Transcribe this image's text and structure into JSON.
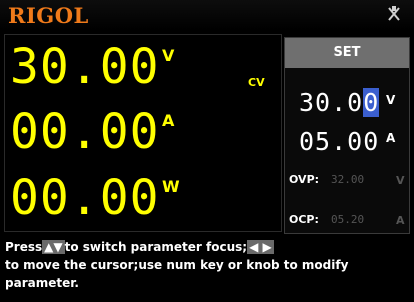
{
  "header": {
    "brand": "RIGOL",
    "status_icon": "no-connection-icon"
  },
  "measure": {
    "voltage": "30.00",
    "voltage_unit": "V",
    "current": "00.00",
    "current_unit": "A",
    "power": "00.00",
    "power_unit": "W",
    "mode": "CV"
  },
  "set_panel": {
    "title": "SET",
    "voltage_head": "30.0",
    "voltage_cursor": "0",
    "voltage_unit": "V",
    "current": "05.00",
    "current_unit": "A",
    "ovp_label": "OVP:",
    "ovp_value": "32.00",
    "ovp_unit": "V",
    "ocp_label": "OCP:",
    "ocp_value": "05.20",
    "ocp_unit": "A"
  },
  "help": {
    "press": "Press",
    "up_key": "▲",
    "down_key": "▼",
    "focus_text": "to switch parameter focus;",
    "left_key": "◀",
    "right_key": "▶",
    "line2": "to move the cursor;use num key or knob to modify parameter."
  },
  "colors": {
    "brand": "#f07a1a",
    "measure": "#ffff00",
    "cursor_highlight": "#3b5fcf"
  }
}
